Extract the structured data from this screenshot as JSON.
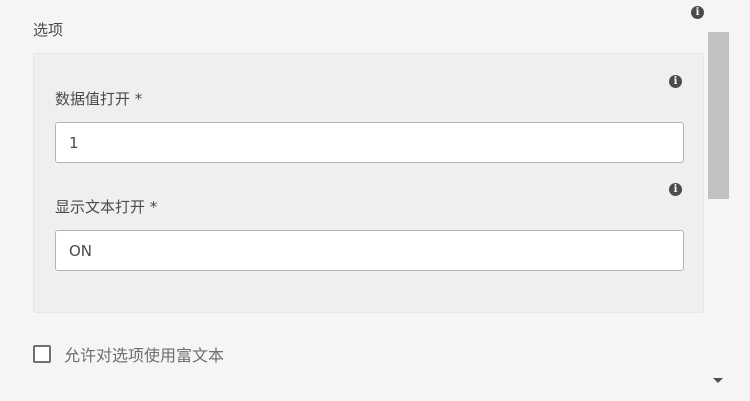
{
  "section": {
    "title": "选项"
  },
  "fields": [
    {
      "label": "数据值打开 *",
      "value": "1"
    },
    {
      "label": "显示文本打开 *",
      "value": "ON"
    }
  ],
  "checkbox": {
    "label": "允许对选项使用富文本",
    "checked": false
  },
  "icons": {
    "info": "i"
  },
  "colors": {
    "background": "#f5f5f5",
    "panel": "#efefef",
    "text": "#4b4b4b",
    "scroll_thumb": "#c1c1c1"
  }
}
